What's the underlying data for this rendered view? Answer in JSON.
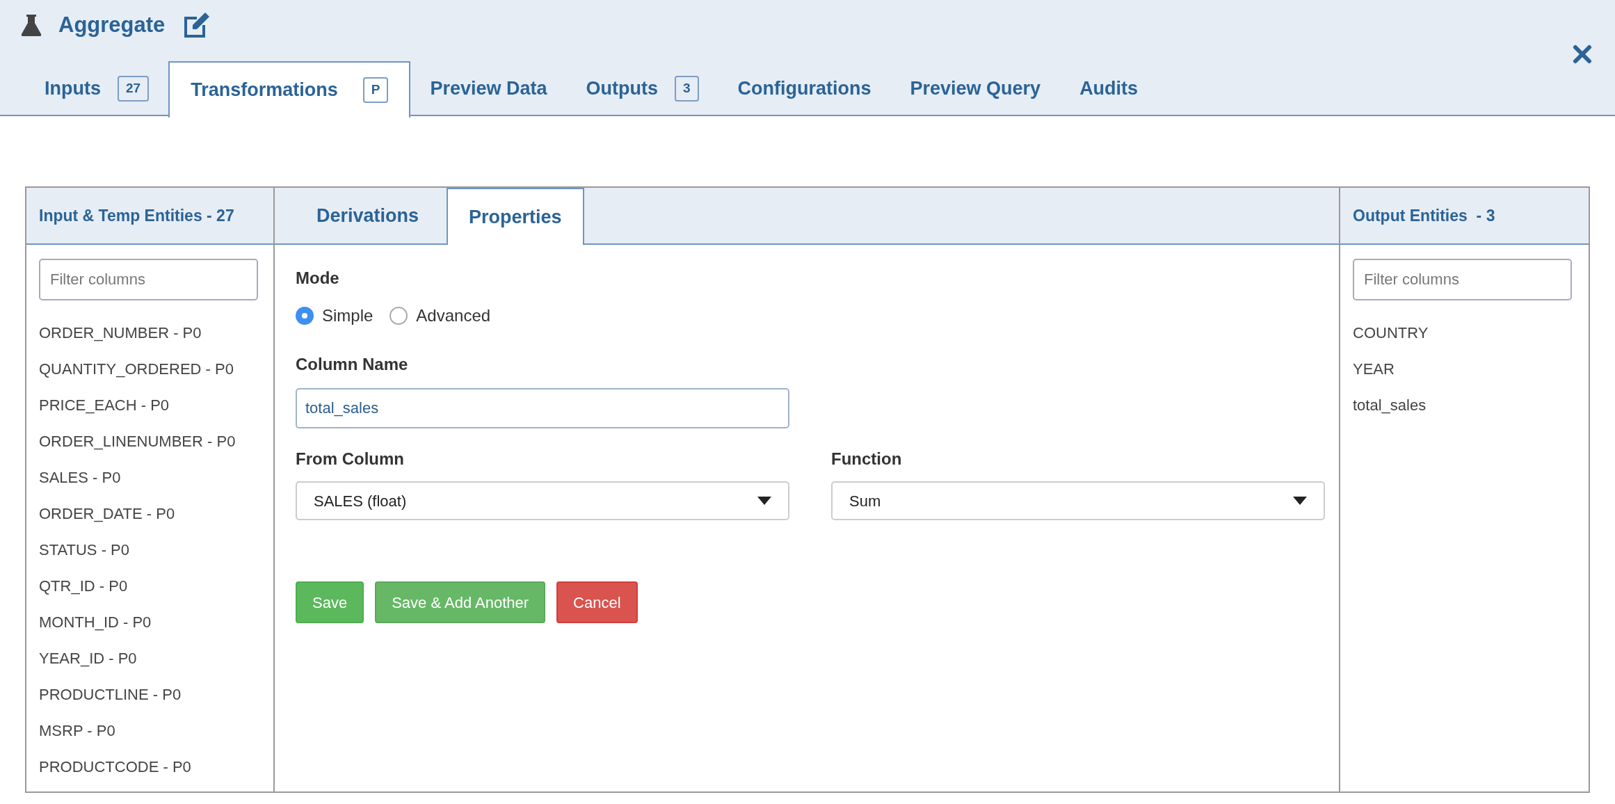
{
  "header": {
    "title": "Aggregate"
  },
  "tabs": [
    {
      "label": "Inputs",
      "badge": "27",
      "selected": false
    },
    {
      "label": "Transformations",
      "badge": "P",
      "selected": true
    },
    {
      "label": "Preview Data",
      "selected": false
    },
    {
      "label": "Outputs",
      "badge": "3",
      "selected": false
    },
    {
      "label": "Configurations",
      "selected": false
    },
    {
      "label": "Preview Query",
      "selected": false
    },
    {
      "label": "Audits",
      "selected": false
    }
  ],
  "input_panel": {
    "title": "Input & Temp Entities - 27",
    "filter": {
      "placeholder": "Filter columns"
    },
    "items": [
      "ORDER_NUMBER - P0",
      "QUANTITY_ORDERED - P0",
      "PRICE_EACH - P0",
      "ORDER_LINENUMBER - P0",
      "SALES - P0",
      "ORDER_DATE - P0",
      "STATUS - P0",
      "QTR_ID - P0",
      "MONTH_ID - P0",
      "YEAR_ID - P0",
      "PRODUCTLINE - P0",
      "MSRP - P0",
      "PRODUCTCODE - P0"
    ]
  },
  "sub_tabs": [
    {
      "label": "Derivations",
      "selected": false
    },
    {
      "label": "Properties",
      "selected": true
    }
  ],
  "form": {
    "mode_label": "Mode",
    "modes": [
      {
        "label": "Simple",
        "selected": true
      },
      {
        "label": "Advanced",
        "selected": false
      }
    ],
    "column_name_label": "Column Name",
    "column_name": "total_sales",
    "from_column_label": "From Column",
    "from_column": "SALES (float)",
    "function_label": "Function",
    "function": "Sum",
    "buttons": [
      {
        "label": "Save",
        "kind": "success"
      },
      {
        "label": "Save & Add Another",
        "kind": "success-light"
      },
      {
        "label": "Cancel",
        "kind": "danger"
      }
    ]
  },
  "output_panel": {
    "title": "Output Entities  - 3",
    "filter": {
      "placeholder": "Filter columns"
    },
    "items": [
      "COUNTRY",
      "YEAR",
      "total_sales"
    ]
  }
}
